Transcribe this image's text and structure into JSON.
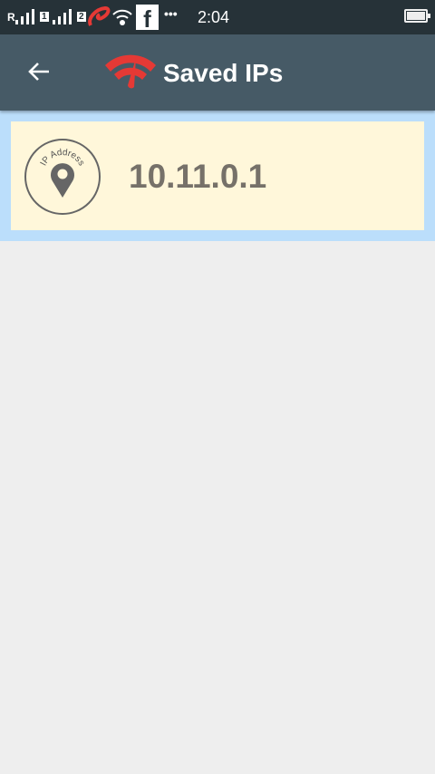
{
  "status_bar": {
    "time": "2:04",
    "carrier_prefix": "R",
    "sim1": "1",
    "sim2": "2",
    "more": "•••",
    "fb_letter": "f"
  },
  "app_bar": {
    "title": "Saved IPs",
    "back_icon": "arrow-left-icon",
    "logo_icon": "wifi-speedometer-logo"
  },
  "saved_ips": [
    {
      "ip": "10.11.0.1",
      "icon_label": "IP Address"
    }
  ],
  "colors": {
    "status_bar": "#263238",
    "app_bar": "#465a66",
    "list_bg": "#bbdefb",
    "card_bg": "#fff7da",
    "logo": "#e53935"
  }
}
